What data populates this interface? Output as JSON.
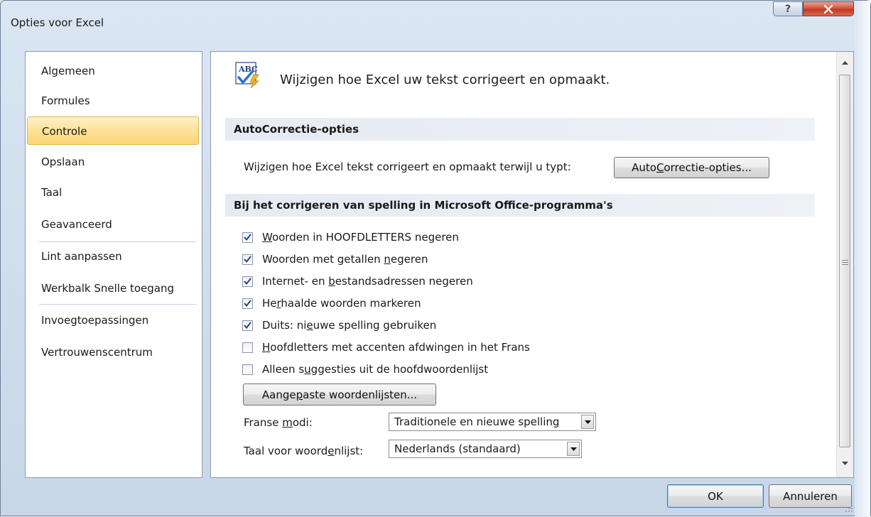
{
  "window": {
    "title": "Opties voor Excel",
    "help_icon": "help-icon",
    "close_icon": "close-icon"
  },
  "nav": {
    "items": [
      {
        "label": "Algemeen"
      },
      {
        "label": "Formules"
      },
      {
        "label": "Controle",
        "selected": true
      },
      {
        "label": "Opslaan"
      },
      {
        "label": "Taal"
      },
      {
        "label": "Geavanceerd"
      },
      {
        "label": "Lint aanpassen"
      },
      {
        "label": "Werkbalk Snelle toegang"
      },
      {
        "label": "Invoegtoepassingen"
      },
      {
        "label": "Vertrouwenscentrum"
      }
    ]
  },
  "content": {
    "heading": "Wijzigen hoe Excel uw tekst corrigeert en opmaakt.",
    "heading_icon": "abc-spellcheck-icon",
    "autocorrect": {
      "section_title": "AutoCorrectie-opties",
      "description": "Wijzigen hoe Excel tekst corrigeert en opmaakt terwijl u typt:",
      "button": {
        "before": "Auto",
        "mnemonic": "C",
        "after": "orrectie-opties..."
      }
    },
    "spelling": {
      "section_title": "Bij het corrigeren van spelling in Microsoft Office-programma's",
      "options": [
        {
          "before": "",
          "mnemonic": "W",
          "after": "oorden in HOOFDLETTERS negeren",
          "checked": true
        },
        {
          "before": "Woorden met getallen ",
          "mnemonic": "n",
          "after": "egeren",
          "checked": true
        },
        {
          "before": "Internet- en ",
          "mnemonic": "b",
          "after": "estandsadressen negeren",
          "checked": true
        },
        {
          "before": "He",
          "mnemonic": "r",
          "after": "haalde woorden markeren",
          "checked": true
        },
        {
          "before": "Duits: ni",
          "mnemonic": "e",
          "after": "uwe spelling gebruiken",
          "checked": true
        },
        {
          "before": "",
          "mnemonic": "H",
          "after": "oofdletters met accenten afdwingen in het Frans",
          "checked": false
        },
        {
          "before": "Alleen s",
          "mnemonic": "u",
          "after": "ggesties uit de hoofdwoordenlijst",
          "checked": false
        }
      ],
      "custom_dict_button": {
        "before": "Aange",
        "mnemonic": "p",
        "after": "aste woordenlijsten..."
      },
      "french_modes": {
        "label": {
          "before": "Franse ",
          "mnemonic": "m",
          "after": "odi:"
        },
        "value": "Traditionele en nieuwe spelling"
      },
      "dictionary_language": {
        "label": {
          "before": "Taal voor woord",
          "mnemonic": "e",
          "after": "nlijst:"
        },
        "value": "Nederlands (standaard)"
      }
    }
  },
  "footer": {
    "ok_label": "OK",
    "cancel_label": "Annuleren"
  },
  "colors": {
    "selected_nav": "#fcd677",
    "section_header": "#e6ebf2",
    "close_button": "#c23a22"
  }
}
